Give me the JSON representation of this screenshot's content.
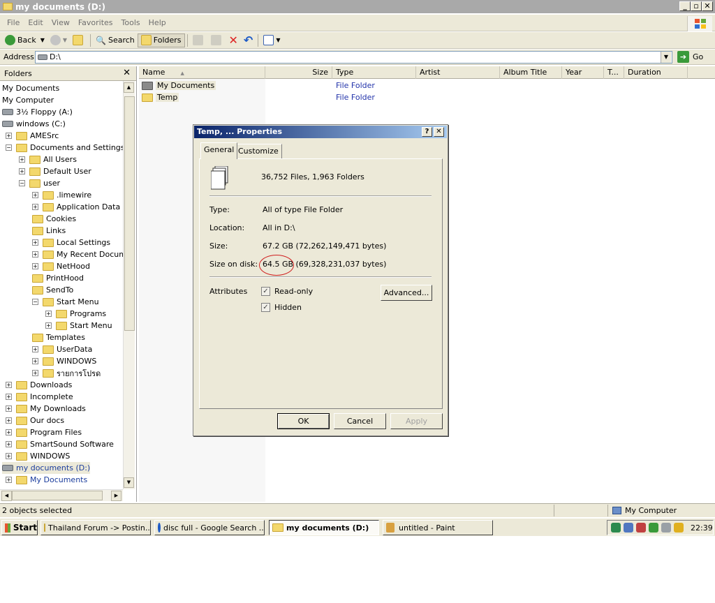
{
  "window": {
    "title": "my documents (D:)",
    "controls": [
      "_",
      "▫",
      "✕"
    ]
  },
  "menu": [
    "File",
    "Edit",
    "View",
    "Favorites",
    "Tools",
    "Help"
  ],
  "toolbar": {
    "back": "Back",
    "search": "Search",
    "folders": "Folders"
  },
  "address": {
    "label": "Address",
    "value": "D:\\",
    "go": "Go"
  },
  "folders_pane": {
    "title": "Folders",
    "close": "✕",
    "tree": [
      {
        "label": "My Documents",
        "level": 0,
        "exp": "",
        "icon": "none"
      },
      {
        "label": "My Computer",
        "level": 0,
        "exp": "",
        "icon": "none"
      },
      {
        "label": "3½ Floppy (A:)",
        "level": 0,
        "exp": "",
        "icon": "drive"
      },
      {
        "label": "windows (C:)",
        "level": 0,
        "exp": "",
        "icon": "drive"
      },
      {
        "label": "AMESrc",
        "level": 1,
        "exp": "+",
        "icon": "folder"
      },
      {
        "label": "Documents and Settings",
        "level": 1,
        "exp": "−",
        "icon": "folder"
      },
      {
        "label": "All Users",
        "level": 2,
        "exp": "+",
        "icon": "folder"
      },
      {
        "label": "Default User",
        "level": 2,
        "exp": "+",
        "icon": "folder"
      },
      {
        "label": "user",
        "level": 2,
        "exp": "−",
        "icon": "folder"
      },
      {
        "label": ".limewire",
        "level": 3,
        "exp": "+",
        "icon": "folder"
      },
      {
        "label": "Application Data",
        "level": 3,
        "exp": "+",
        "icon": "folder"
      },
      {
        "label": "Cookies",
        "level": 3,
        "exp": "",
        "icon": "folder"
      },
      {
        "label": "Links",
        "level": 3,
        "exp": "",
        "icon": "folder"
      },
      {
        "label": "Local Settings",
        "level": 3,
        "exp": "+",
        "icon": "folder"
      },
      {
        "label": "My Recent Documents",
        "level": 3,
        "exp": "+",
        "icon": "folder"
      },
      {
        "label": "NetHood",
        "level": 3,
        "exp": "+",
        "icon": "folder"
      },
      {
        "label": "PrintHood",
        "level": 3,
        "exp": "",
        "icon": "folder"
      },
      {
        "label": "SendTo",
        "level": 3,
        "exp": "",
        "icon": "folder"
      },
      {
        "label": "Start Menu",
        "level": 3,
        "exp": "−",
        "icon": "folder"
      },
      {
        "label": "Programs",
        "level": 4,
        "exp": "+",
        "icon": "folder"
      },
      {
        "label": "Start Menu",
        "level": 4,
        "exp": "+",
        "icon": "folder"
      },
      {
        "label": "Templates",
        "level": 3,
        "exp": "",
        "icon": "folder"
      },
      {
        "label": "UserData",
        "level": 3,
        "exp": "+",
        "icon": "folder"
      },
      {
        "label": "WINDOWS",
        "level": 3,
        "exp": "+",
        "icon": "folder"
      },
      {
        "label": "รายการโปรด",
        "level": 3,
        "exp": "+",
        "icon": "folder"
      },
      {
        "label": "Downloads",
        "level": 1,
        "exp": "+",
        "icon": "folder"
      },
      {
        "label": "Incomplete",
        "level": 1,
        "exp": "+",
        "icon": "folder"
      },
      {
        "label": "My Downloads",
        "level": 1,
        "exp": "+",
        "icon": "folder"
      },
      {
        "label": "Our docs",
        "level": 1,
        "exp": "+",
        "icon": "folder"
      },
      {
        "label": "Program Files",
        "level": 1,
        "exp": "+",
        "icon": "folder"
      },
      {
        "label": "SmartSound Software",
        "level": 1,
        "exp": "+",
        "icon": "folder"
      },
      {
        "label": "WINDOWS",
        "level": 1,
        "exp": "+",
        "icon": "folder"
      },
      {
        "label": "my documents (D:)",
        "level": 0,
        "exp": "",
        "icon": "drive",
        "selected": true
      },
      {
        "label": "My Documents",
        "level": 1,
        "exp": "+",
        "icon": "folder",
        "blue": true
      }
    ]
  },
  "list": {
    "columns": [
      "Name",
      "Size",
      "Type",
      "Artist",
      "Album Title",
      "Year",
      "T...",
      "Duration"
    ],
    "items": [
      {
        "name": "My Documents",
        "type": "File Folder"
      },
      {
        "name": "Temp",
        "type": "File Folder"
      }
    ]
  },
  "dialog": {
    "title": "Temp, ... Properties",
    "help": "?",
    "close": "✕",
    "tabs": [
      "General",
      "Customize"
    ],
    "summary": "36,752 Files, 1,963 Folders",
    "fields": [
      {
        "label": "Type:",
        "value": "All of type File Folder"
      },
      {
        "label": "Location:",
        "value": "All in D:\\"
      },
      {
        "label": "Size:",
        "value": "67.2 GB (72,262,149,471 bytes)"
      },
      {
        "label": "Size on disk:",
        "value": "64.5 GB (69,328,231,037 bytes)"
      }
    ],
    "attributes_label": "Attributes",
    "readonly": "Read-only",
    "hidden": "Hidden",
    "advanced": "Advanced...",
    "ok": "OK",
    "cancel": "Cancel",
    "apply": "Apply"
  },
  "status": {
    "left": "2 objects selected",
    "right": "My Computer"
  },
  "taskbar": {
    "start": "Start",
    "tasks": [
      "Thailand Forum -> Postin...",
      "disc full - Google Search ...",
      "my documents (D:)",
      "untitled - Paint"
    ],
    "clock": "22:39"
  }
}
